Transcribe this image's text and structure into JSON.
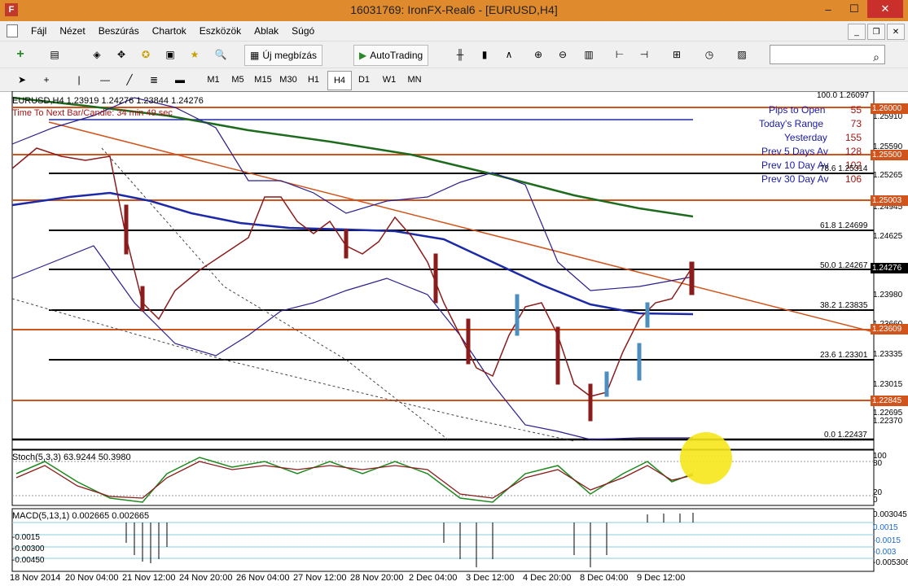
{
  "window": {
    "title": "16031769: IronFX-Real6 - [EURUSD,H4]",
    "icon_letter": "F"
  },
  "menu": [
    "Fájl",
    "Nézet",
    "Beszúrás",
    "Chartok",
    "Eszközök",
    "Ablak",
    "Súgó"
  ],
  "toolbar": {
    "new_order_label": "Új megbízás",
    "autotrading_label": "AutoTrading"
  },
  "timeframes": [
    "M1",
    "M5",
    "M15",
    "M30",
    "H1",
    "H4",
    "D1",
    "W1",
    "MN"
  ],
  "selected_timeframe": "H4",
  "chart": {
    "info_line": "EURUSD,H4  1.23919 1.24276 1.23844 1.24276",
    "timer_text": "Time To Next Bar/Candle: 34 min 49 sec",
    "stats": [
      {
        "label": "Pips to Open",
        "value": "55"
      },
      {
        "label": "Today's Range",
        "value": "73"
      },
      {
        "label": "Yesterday",
        "value": "155"
      },
      {
        "label": "Prev 5 Days Av",
        "value": "128"
      },
      {
        "label": "Prev 10 Day Av",
        "value": "102"
      },
      {
        "label": "Prev 30 Day Av",
        "value": "106"
      }
    ],
    "fib_levels": [
      {
        "label": "100.0 1.26097"
      },
      {
        "label": "78.6 1.25314"
      },
      {
        "label": "61.8 1.24699"
      },
      {
        "label": "50.0 1.24267"
      },
      {
        "label": "38.2 1.23835"
      },
      {
        "label": "23.6 1.23301"
      },
      {
        "label": "0.0 1.22437"
      }
    ],
    "price_tags": [
      "1.26000",
      "1.25500",
      "1.25003",
      "1.24276",
      "1.23609",
      "1.22845"
    ],
    "price_axis": [
      "1.25910",
      "1.25590",
      "1.25265",
      "1.24945",
      "1.24625",
      "1.23980",
      "1.23660",
      "1.23335",
      "1.23015",
      "1.22695",
      "1.22370"
    ],
    "time_axis": [
      "18 Nov 2014",
      "20 Nov 04:00",
      "21 Nov 12:00",
      "24 Nov 20:00",
      "26 Nov 04:00",
      "27 Nov 12:00",
      "28 Nov 20:00",
      "2 Dec 04:00",
      "3 Dec 12:00",
      "4 Dec 20:00",
      "8 Dec 04:00",
      "9 Dec 12:00"
    ],
    "stoch_label": "Stoch(5,3,3) 63.9244 50.3980",
    "stoch_axis": [
      "100",
      "80",
      "20",
      "0"
    ],
    "macd_label": "MACD(5,13,1) 0.002665 0.002665",
    "macd_axis_left": [
      "-0.0015",
      "-0.00300",
      "-0.00450"
    ],
    "macd_axis_right": [
      "0.003045",
      "0.0015",
      "-0.0015",
      "-0.003",
      "-0.005306"
    ]
  },
  "colors": {
    "orange_line": "#d1541d",
    "green_ma": "#1e6b1e",
    "blue_ma": "#1c2aa8"
  }
}
